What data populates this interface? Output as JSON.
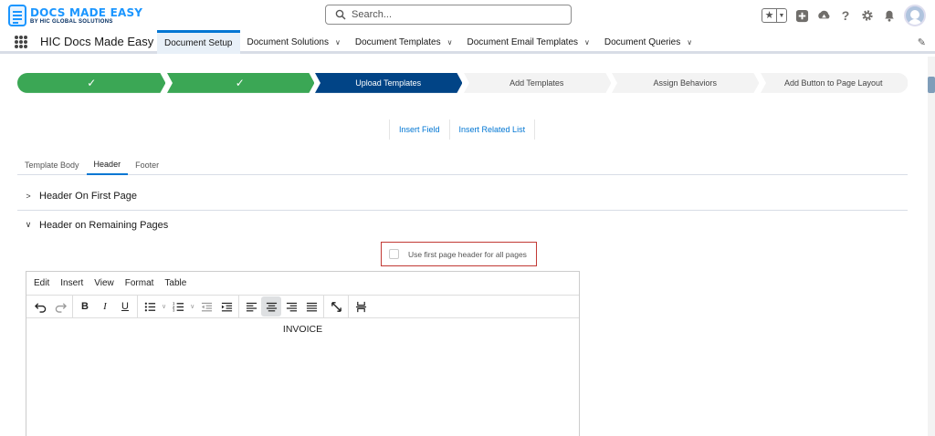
{
  "header": {
    "logo_title": "DOCS MADE EASY",
    "logo_subtitle": "BY HIC GLOBAL SOLUTIONS",
    "search_placeholder": "Search...",
    "icons": [
      "favorites-star-icon",
      "add-icon",
      "trailhead-icon",
      "help-icon",
      "gear-icon",
      "bell-icon",
      "avatar"
    ]
  },
  "nav": {
    "app_name": "HIC Docs Made Easy",
    "tabs": [
      {
        "label": "Document Setup",
        "active": true,
        "has_menu": false
      },
      {
        "label": "Document Solutions",
        "active": false,
        "has_menu": true
      },
      {
        "label": "Document Templates",
        "active": false,
        "has_menu": true
      },
      {
        "label": "Document Email Templates",
        "active": false,
        "has_menu": true
      },
      {
        "label": "Document Queries",
        "active": false,
        "has_menu": true
      }
    ]
  },
  "path": {
    "steps": [
      {
        "label": "",
        "state": "complete"
      },
      {
        "label": "",
        "state": "complete"
      },
      {
        "label": "Upload Templates",
        "state": "current"
      },
      {
        "label": "Add Templates",
        "state": "incomplete"
      },
      {
        "label": "Assign Behaviors",
        "state": "incomplete"
      },
      {
        "label": "Add Button to Page Layout",
        "state": "incomplete"
      }
    ],
    "colors": {
      "complete": "#3ba755",
      "current": "#014486",
      "incomplete": "#f3f3f3"
    }
  },
  "actions": {
    "insert_field": "Insert Field",
    "insert_related_list": "Insert Related List"
  },
  "subtabs": {
    "items": [
      {
        "label": "Template Body",
        "active": false
      },
      {
        "label": "Header",
        "active": true
      },
      {
        "label": "Footer",
        "active": false
      }
    ]
  },
  "sections": {
    "first_page": "Header On First Page",
    "remaining_pages": "Header on Remaining Pages"
  },
  "option": {
    "label": "Use first page header for all pages",
    "checked": false,
    "highlight_color": "#c23934"
  },
  "editor": {
    "menus": [
      "Edit",
      "Insert",
      "View",
      "Format",
      "Table"
    ],
    "content": "INVOICE"
  }
}
